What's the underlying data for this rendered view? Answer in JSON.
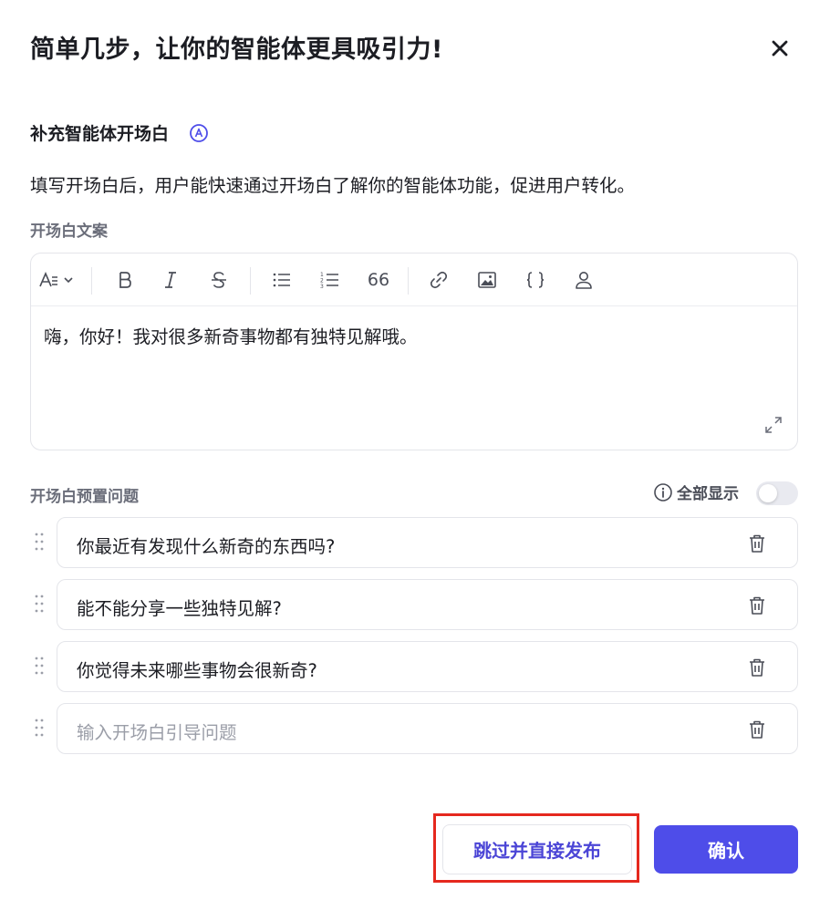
{
  "dialog": {
    "title": "简单几步，让你的智能体更具吸引力!"
  },
  "opening": {
    "section_title": "补充智能体开场白",
    "description": "填写开场白后，用户能快速通过开场白了解你的智能体功能，促进用户转化。",
    "copy_label": "开场白文案",
    "editor_text": "嗨，你好！我对很多新奇事物都有独特见解哦。",
    "toolbar": [
      "text-style-icon",
      "bold-icon",
      "italic-icon",
      "strikethrough-icon",
      "bullet-list-icon",
      "ordered-list-icon",
      "quote-icon",
      "link-icon",
      "image-icon",
      "code-braces-icon",
      "user-icon"
    ],
    "quote_glyph": "66"
  },
  "questions": {
    "label": "开场白预置问题",
    "show_all_label": "全部显示",
    "show_all_enabled": false,
    "items": [
      "你最近有发现什么新奇的东西吗?",
      "能不能分享一些独特见解?",
      "你觉得未来哪些事物会很新奇?"
    ],
    "input_placeholder": "输入开场白引导问题"
  },
  "footer": {
    "skip_label": "跳过并直接发布",
    "confirm_label": "确认"
  },
  "colors": {
    "accent": "#4e4de9",
    "highlight": "#e5281e",
    "text": "#1c1d23",
    "muted": "#6b6e7a"
  }
}
